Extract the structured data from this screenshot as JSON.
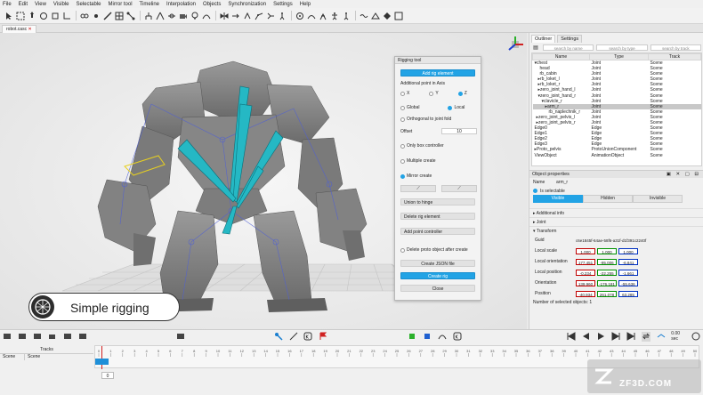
{
  "menu": [
    "File",
    "Edit",
    "View",
    "Visible",
    "Selectable",
    "Mirror tool",
    "Timeline",
    "Interpolation",
    "Objects",
    "Synchronization",
    "Settings",
    "Help"
  ],
  "document_tab": "robot.casc",
  "rig_tool": {
    "title": "Rigging tool",
    "add_rig_element": "Add rig element",
    "additional_point": "Additional point in Axis",
    "axes": [
      "X",
      "Y",
      "Z"
    ],
    "global": "Global",
    "local": "Local",
    "orthogonal": "Orthogonal to joint fold",
    "offset_label": "Offset",
    "offset_value": "10",
    "only_box": "Only box controller",
    "multiple_create": "Multiple create",
    "mirror_create": "Mirror create",
    "union_to_hinge": "Union to hinge",
    "delete_rig": "Delete rig element",
    "add_point": "Add point controller",
    "delete_proto": "Delete proto object after create",
    "create_json": "Create JSON file",
    "create_rig": "Create rig",
    "close": "Close"
  },
  "badge": {
    "text": "Simple rigging"
  },
  "outliner": {
    "tabs": [
      "Outliner",
      "Settings"
    ],
    "search": [
      "search by name",
      "search by type",
      "search by track"
    ],
    "headers": [
      "Name",
      "Type",
      "Track"
    ],
    "rows": [
      {
        "name": "▾chest",
        "type": "Joint",
        "track": "Scene"
      },
      {
        "name": "head",
        "type": "Joint",
        "track": "Scene"
      },
      {
        "name": "rb_cabin",
        "type": "Joint",
        "track": "Scene"
      },
      {
        "name": "▸rb_loket_l",
        "type": "Joint",
        "track": "Scene"
      },
      {
        "name": "▸rb_loket_r",
        "type": "Joint",
        "track": "Scene"
      },
      {
        "name": "▸zero_joint_hand_l",
        "type": "Joint",
        "track": "Scene"
      },
      {
        "name": "▾zero_joint_hand_r",
        "type": "Joint",
        "track": "Scene"
      },
      {
        "name": "▾clavicle_r",
        "type": "Joint",
        "track": "Scene"
      },
      {
        "name": "▸arm_r",
        "type": "Joint",
        "track": "Scene"
      },
      {
        "name": "rb_naplechnik_r",
        "type": "Joint",
        "track": "Scene"
      },
      {
        "name": "▸zero_joint_pelvis_l",
        "type": "Joint",
        "track": "Scene"
      },
      {
        "name": "▸zero_joint_pelvis_r",
        "type": "Joint",
        "track": "Scene"
      },
      {
        "name": "Edge0",
        "type": "Edge",
        "track": "Scene"
      },
      {
        "name": "Edge1",
        "type": "Edge",
        "track": "Scene"
      },
      {
        "name": "Edge2",
        "type": "Edge",
        "track": "Scene"
      },
      {
        "name": "Edge3",
        "type": "Edge",
        "track": "Scene"
      },
      {
        "name": "▸Proto_pelvis",
        "type": "ProtoUnionComponent",
        "track": "Scene"
      },
      {
        "name": "ViewObject",
        "type": "AnimationObject",
        "track": "Scene"
      }
    ]
  },
  "properties": {
    "title": "Object properties",
    "name_label": "Name",
    "name_value": "arm_r",
    "is_selectable": "Is selectable",
    "visibility": [
      "Visible",
      "Hidden",
      "Invisible"
    ],
    "sections": [
      "Additional info",
      "Joint",
      "Transform"
    ],
    "guid_label": "Guid",
    "guid_value": "c6e1845f-64ae-58f6-a31f-d1f391c2240f",
    "rows": [
      {
        "label": "Local scale",
        "values": [
          "1.000",
          "1.000",
          "1.000"
        ]
      },
      {
        "label": "Local orientation",
        "values": [
          "177.451",
          "-95.006",
          "-6.841"
        ]
      },
      {
        "label": "Local position",
        "values": [
          "-0.234",
          "-22.255",
          "-1.661"
        ]
      },
      {
        "label": "Orientation",
        "values": [
          "139.960",
          "-176.181",
          "-55.636"
        ]
      },
      {
        "label": "Position",
        "values": [
          "-40.934",
          "261.078",
          "63.285"
        ]
      }
    ],
    "selected_count": "Number of selected objects: 1"
  },
  "timeline": {
    "tracks_label": "Tracks",
    "track_name": "Scene",
    "track_name2": "Scene",
    "time_readout": "0.00 sec",
    "frame_value": "0",
    "ticks": [
      "0",
      "1",
      "2",
      "3",
      "4",
      "5",
      "6",
      "7",
      "8",
      "9",
      "10",
      "11",
      "12",
      "13",
      "14",
      "15",
      "16",
      "17",
      "18",
      "19",
      "20",
      "21",
      "22",
      "23",
      "24",
      "25",
      "26",
      "27",
      "28",
      "29",
      "30",
      "31",
      "32",
      "33",
      "34",
      "35",
      "36",
      "37",
      "38",
      "39",
      "40",
      "41",
      "42",
      "43",
      "44",
      "45",
      "46",
      "47",
      "48",
      "49",
      "50"
    ]
  },
  "watermark": {
    "text": "ZF3D.COM"
  },
  "colors": {
    "accent": "#22a3e5",
    "bone": "#25b8c4",
    "mesh": "#7c7c7c"
  }
}
